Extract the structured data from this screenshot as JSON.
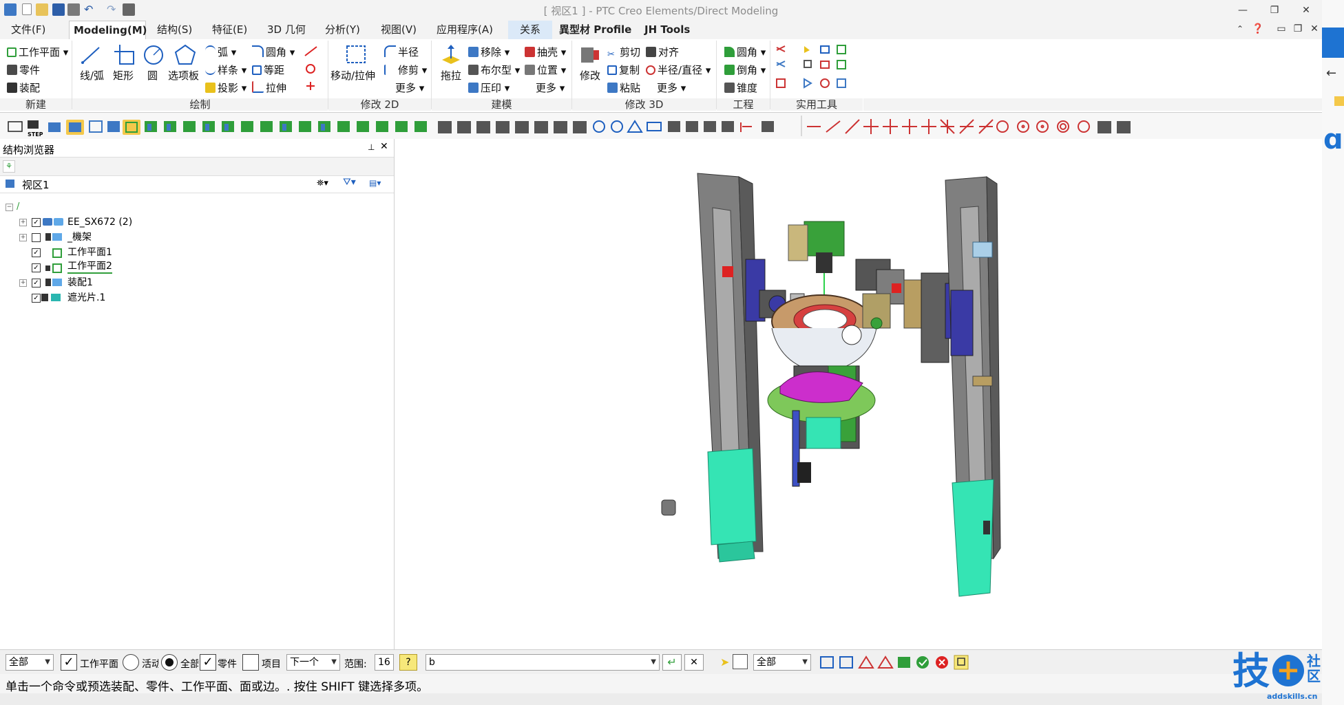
{
  "window": {
    "title": "[ 视区1 ] - PTC Creo Elements/Direct Modeling"
  },
  "menu": {
    "tabs": [
      "文件(F)",
      "Modeling(M)",
      "结构(S)",
      "特征(E)",
      "3D 几何",
      "分析(Y)",
      "视图(V)",
      "应用程序(A)",
      "关系",
      "異型材 Profile",
      "JH Tools"
    ],
    "active_tab": "Modeling(M)"
  },
  "ribbon": {
    "new_group": {
      "label": "新建",
      "items": [
        "工作平面",
        "零件",
        "装配"
      ]
    },
    "draw_group": {
      "label": "绘制",
      "big": [
        "线/弧",
        "矩形",
        "圆",
        "选项板"
      ],
      "small": [
        "弧",
        "样条",
        "投影",
        "圆角",
        "等距",
        "拉伸"
      ]
    },
    "modify2d_group": {
      "label": "修改 2D",
      "big": [
        "移动/拉伸"
      ],
      "small": [
        "半径",
        "修剪",
        "更多"
      ]
    },
    "model_group": {
      "label": "建模",
      "big": [
        "拖拉"
      ],
      "small": [
        "移除",
        "布尔型",
        "压印",
        "抽壳",
        "位置",
        "更多"
      ]
    },
    "modify3d_group": {
      "label": "修改 3D",
      "big": [
        "修改"
      ],
      "small": [
        "剪切",
        "复制",
        "粘贴",
        "对齐",
        "半径/直径",
        "更多"
      ]
    },
    "engineering_group": {
      "label": "工程",
      "small": [
        "圆角",
        "倒角",
        "锥度"
      ]
    },
    "utility_group": {
      "label": "实用工具"
    }
  },
  "browser": {
    "title": "结构浏览器",
    "viewport_label": "视区1",
    "tree": [
      {
        "label": "EE_SX672 (2)",
        "checked": true
      },
      {
        "label": "_機架",
        "checked": false
      },
      {
        "label": "工作平面1",
        "checked": true
      },
      {
        "label": "工作平面2",
        "checked": true
      },
      {
        "label": "装配1",
        "checked": true
      },
      {
        "label": "遮光片.1",
        "checked": true
      }
    ]
  },
  "bottom": {
    "filter_combo": "全部",
    "cb_workplane": "工作平面",
    "radio_active": "活动",
    "radio_all": "全部",
    "cb_part": "零件",
    "cb_item": "项目",
    "next_combo": "下一个",
    "range_label": "范围:",
    "range_value": "16",
    "command_input": "b",
    "select_combo": "全部"
  },
  "status": {
    "message": "单击一个命令或预选装配、零件、工作平面、面或边。. 按住 SHIFT 键选择多项。"
  },
  "watermark": {
    "logo_text": "技",
    "sub": "社区",
    "url": "addskills.cn"
  },
  "colors": {
    "accent": "#1e73d2",
    "active_tab_bg": "#ffffff",
    "relation_tab_bg": "#dbe9f8",
    "cyan_part": "#33e6b8"
  }
}
